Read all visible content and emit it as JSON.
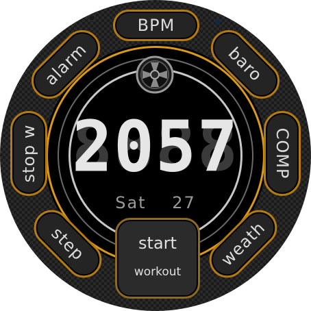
{
  "watch_face": {
    "colors": {
      "accent": "#d99a1a",
      "pill_bg": "#242424",
      "text": "#dcdcdc"
    },
    "time": {
      "digits": "2057",
      "ghost_digits": "8888"
    },
    "date": {
      "day": "Sat",
      "date": "27"
    },
    "complications": {
      "top": "BPM",
      "top_left": "alarm",
      "top_right": "baro",
      "left": "stop w",
      "right": "COMP",
      "bottom_left": "step",
      "bottom_right": "weath"
    },
    "start_button": {
      "line1": "start",
      "line2": "workout"
    },
    "center_icon": "turbine-wheel-icon"
  }
}
